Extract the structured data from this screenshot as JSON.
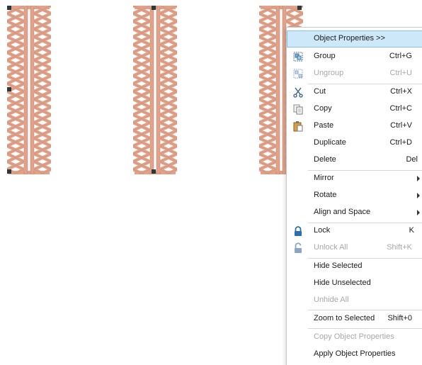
{
  "canvas": {
    "stitch_color": "#e0a28a",
    "stitch_dark": "#c07a62",
    "handle_color": "#2a3a3a"
  },
  "menu": {
    "highlight_color": "#cde8f8",
    "items": {
      "object_properties": {
        "label": "Object Properties >>"
      },
      "group": {
        "label": "Group",
        "shortcut": "Ctrl+G",
        "icon": "group-icon"
      },
      "ungroup": {
        "label": "Ungroup",
        "shortcut": "Ctrl+U",
        "icon": "ungroup-icon"
      },
      "cut": {
        "label": "Cut",
        "shortcut": "Ctrl+X",
        "icon": "scissors-icon"
      },
      "copy": {
        "label": "Copy",
        "shortcut": "Ctrl+C",
        "icon": "copy-icon"
      },
      "paste": {
        "label": "Paste",
        "shortcut": "Ctrl+V",
        "icon": "paste-icon"
      },
      "duplicate": {
        "label": "Duplicate",
        "shortcut": "Ctrl+D"
      },
      "delete": {
        "label": "Delete",
        "shortcut": "Del"
      },
      "mirror": {
        "label": "Mirror"
      },
      "rotate": {
        "label": "Rotate"
      },
      "align": {
        "label": "Align and Space"
      },
      "lock": {
        "label": "Lock",
        "shortcut": "K",
        "icon": "lock-icon"
      },
      "unlock_all": {
        "label": "Unlock All",
        "shortcut": "Shift+K",
        "icon": "unlock-icon"
      },
      "hide_selected": {
        "label": "Hide Selected"
      },
      "hide_unselected": {
        "label": "Hide Unselected"
      },
      "unhide_all": {
        "label": "Unhide All"
      },
      "zoom_selected": {
        "label": "Zoom to Selected",
        "shortcut": "Shift+0"
      },
      "copy_props": {
        "label": "Copy Object Properties"
      },
      "apply_props": {
        "label": "Apply Object Properties"
      }
    }
  }
}
